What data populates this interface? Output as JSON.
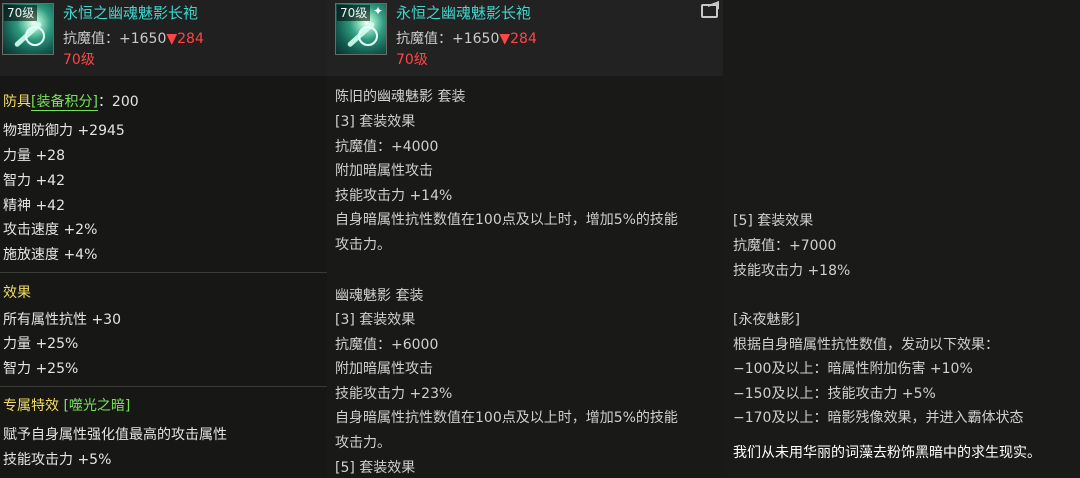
{
  "item": {
    "level_badge": "70级",
    "name": "永恒之幽魂魅影长袍",
    "magic_res_label": "抗魔值：+1650",
    "magic_res_down": "▼284",
    "req_level": "70级"
  },
  "left": {
    "armor_prefix": "防具",
    "armor_score_label": "[装备积分]",
    "armor_score_value": "：200",
    "stats": [
      "物理防御力 +2945",
      "力量 +28",
      "智力 +42",
      "精神 +42",
      "攻击速度 +2%",
      "施放速度 +4%"
    ],
    "effect_header": "效果",
    "effects": [
      "所有属性抗性 +30",
      "力量 +25%",
      "智力 +25%"
    ],
    "special_header": "专属特效",
    "special_name": "[噬光之暗]",
    "special_lines": [
      "赋予自身属性强化值最高的攻击属性",
      "技能攻击力 +5%"
    ]
  },
  "middle": {
    "lines": [
      "陈旧的幽魂魅影  套装",
      "[3] 套装效果",
      "抗魔值：+4000",
      "附加暗属性攻击",
      "技能攻击力 +14%",
      "自身暗属性抗性数值在100点及以上时，增加5%的技能",
      "攻击力。",
      "",
      "幽魂魅影  套装",
      "[3] 套装效果",
      "抗魔值：+6000",
      "附加暗属性攻击",
      "技能攻击力 +23%",
      "自身暗属性抗性数值在100点及以上时，增加5%的技能",
      "攻击力。",
      "[5] 套装效果"
    ]
  },
  "right": {
    "lines": [
      "[5] 套装效果",
      "抗魔值：+7000",
      "技能攻击力 +18%",
      "",
      "[永夜魅影]",
      "根据自身暗属性抗性数值，发动以下效果：",
      "−100及以上：暗属性附加伤害 +10%",
      "−150及以上：技能攻击力 +5%",
      "−170及以上：暗影残像效果，并进入霸体状态"
    ],
    "flavor": "我们从未用华丽的词藻去粉饰黑暗中的求生现实。"
  }
}
